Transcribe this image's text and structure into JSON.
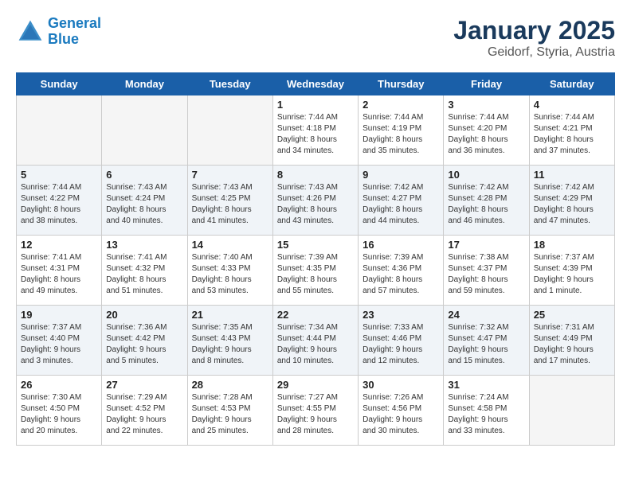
{
  "header": {
    "logo_line1": "General",
    "logo_line2": "Blue",
    "month": "January 2025",
    "location": "Geidorf, Styria, Austria"
  },
  "days_of_week": [
    "Sunday",
    "Monday",
    "Tuesday",
    "Wednesday",
    "Thursday",
    "Friday",
    "Saturday"
  ],
  "weeks": [
    [
      {
        "day": "",
        "content": ""
      },
      {
        "day": "",
        "content": ""
      },
      {
        "day": "",
        "content": ""
      },
      {
        "day": "1",
        "content": "Sunrise: 7:44 AM\nSunset: 4:18 PM\nDaylight: 8 hours\nand 34 minutes."
      },
      {
        "day": "2",
        "content": "Sunrise: 7:44 AM\nSunset: 4:19 PM\nDaylight: 8 hours\nand 35 minutes."
      },
      {
        "day": "3",
        "content": "Sunrise: 7:44 AM\nSunset: 4:20 PM\nDaylight: 8 hours\nand 36 minutes."
      },
      {
        "day": "4",
        "content": "Sunrise: 7:44 AM\nSunset: 4:21 PM\nDaylight: 8 hours\nand 37 minutes."
      }
    ],
    [
      {
        "day": "5",
        "content": "Sunrise: 7:44 AM\nSunset: 4:22 PM\nDaylight: 8 hours\nand 38 minutes."
      },
      {
        "day": "6",
        "content": "Sunrise: 7:43 AM\nSunset: 4:24 PM\nDaylight: 8 hours\nand 40 minutes."
      },
      {
        "day": "7",
        "content": "Sunrise: 7:43 AM\nSunset: 4:25 PM\nDaylight: 8 hours\nand 41 minutes."
      },
      {
        "day": "8",
        "content": "Sunrise: 7:43 AM\nSunset: 4:26 PM\nDaylight: 8 hours\nand 43 minutes."
      },
      {
        "day": "9",
        "content": "Sunrise: 7:42 AM\nSunset: 4:27 PM\nDaylight: 8 hours\nand 44 minutes."
      },
      {
        "day": "10",
        "content": "Sunrise: 7:42 AM\nSunset: 4:28 PM\nDaylight: 8 hours\nand 46 minutes."
      },
      {
        "day": "11",
        "content": "Sunrise: 7:42 AM\nSunset: 4:29 PM\nDaylight: 8 hours\nand 47 minutes."
      }
    ],
    [
      {
        "day": "12",
        "content": "Sunrise: 7:41 AM\nSunset: 4:31 PM\nDaylight: 8 hours\nand 49 minutes."
      },
      {
        "day": "13",
        "content": "Sunrise: 7:41 AM\nSunset: 4:32 PM\nDaylight: 8 hours\nand 51 minutes."
      },
      {
        "day": "14",
        "content": "Sunrise: 7:40 AM\nSunset: 4:33 PM\nDaylight: 8 hours\nand 53 minutes."
      },
      {
        "day": "15",
        "content": "Sunrise: 7:39 AM\nSunset: 4:35 PM\nDaylight: 8 hours\nand 55 minutes."
      },
      {
        "day": "16",
        "content": "Sunrise: 7:39 AM\nSunset: 4:36 PM\nDaylight: 8 hours\nand 57 minutes."
      },
      {
        "day": "17",
        "content": "Sunrise: 7:38 AM\nSunset: 4:37 PM\nDaylight: 8 hours\nand 59 minutes."
      },
      {
        "day": "18",
        "content": "Sunrise: 7:37 AM\nSunset: 4:39 PM\nDaylight: 9 hours\nand 1 minute."
      }
    ],
    [
      {
        "day": "19",
        "content": "Sunrise: 7:37 AM\nSunset: 4:40 PM\nDaylight: 9 hours\nand 3 minutes."
      },
      {
        "day": "20",
        "content": "Sunrise: 7:36 AM\nSunset: 4:42 PM\nDaylight: 9 hours\nand 5 minutes."
      },
      {
        "day": "21",
        "content": "Sunrise: 7:35 AM\nSunset: 4:43 PM\nDaylight: 9 hours\nand 8 minutes."
      },
      {
        "day": "22",
        "content": "Sunrise: 7:34 AM\nSunset: 4:44 PM\nDaylight: 9 hours\nand 10 minutes."
      },
      {
        "day": "23",
        "content": "Sunrise: 7:33 AM\nSunset: 4:46 PM\nDaylight: 9 hours\nand 12 minutes."
      },
      {
        "day": "24",
        "content": "Sunrise: 7:32 AM\nSunset: 4:47 PM\nDaylight: 9 hours\nand 15 minutes."
      },
      {
        "day": "25",
        "content": "Sunrise: 7:31 AM\nSunset: 4:49 PM\nDaylight: 9 hours\nand 17 minutes."
      }
    ],
    [
      {
        "day": "26",
        "content": "Sunrise: 7:30 AM\nSunset: 4:50 PM\nDaylight: 9 hours\nand 20 minutes."
      },
      {
        "day": "27",
        "content": "Sunrise: 7:29 AM\nSunset: 4:52 PM\nDaylight: 9 hours\nand 22 minutes."
      },
      {
        "day": "28",
        "content": "Sunrise: 7:28 AM\nSunset: 4:53 PM\nDaylight: 9 hours\nand 25 minutes."
      },
      {
        "day": "29",
        "content": "Sunrise: 7:27 AM\nSunset: 4:55 PM\nDaylight: 9 hours\nand 28 minutes."
      },
      {
        "day": "30",
        "content": "Sunrise: 7:26 AM\nSunset: 4:56 PM\nDaylight: 9 hours\nand 30 minutes."
      },
      {
        "day": "31",
        "content": "Sunrise: 7:24 AM\nSunset: 4:58 PM\nDaylight: 9 hours\nand 33 minutes."
      },
      {
        "day": "",
        "content": ""
      }
    ]
  ]
}
